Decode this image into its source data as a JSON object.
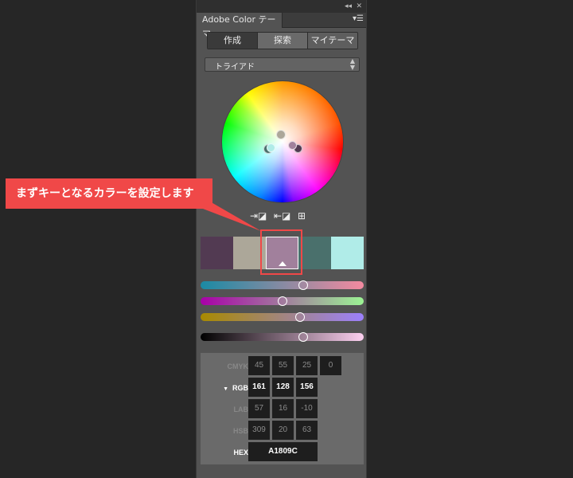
{
  "panel": {
    "title_tab": "Adobe Color テーマ",
    "titlebar_icons": [
      "collapse-icon",
      "close-icon"
    ],
    "menu_icon": "panel-menu-icon"
  },
  "modes": [
    {
      "label": "作成",
      "active": true
    },
    {
      "label": "探索",
      "active": false
    },
    {
      "label": "マイテーマ",
      "active": false
    }
  ],
  "harmony_rule": {
    "selected": "トライアド"
  },
  "actions": [
    {
      "name": "set-from-foreground-icon",
      "glyph": "⇥⧉"
    },
    {
      "name": "set-from-background-icon",
      "glyph": "⇤⧉"
    },
    {
      "name": "add-to-swatches-icon",
      "glyph": "▦"
    }
  ],
  "swatches": [
    {
      "color": "#523a52",
      "selected": false
    },
    {
      "color": "#aca799",
      "selected": false
    },
    {
      "color": "#a1809c",
      "selected": true
    },
    {
      "color": "#4a706c",
      "selected": false
    },
    {
      "color": "#b0ece8",
      "selected": false
    }
  ],
  "sliders": [
    {
      "name": "slider-1",
      "gradient": [
        "#1a8aa4",
        "#f48aa0"
      ],
      "value_pct": 63
    },
    {
      "name": "slider-2",
      "gradient": [
        "#a800a8",
        "#9cf494"
      ],
      "value_pct": 50
    },
    {
      "name": "slider-3",
      "gradient": [
        "#a88a00",
        "#9c80fc"
      ],
      "value_pct": 61
    },
    {
      "name": "brightness-slider",
      "gradient": [
        "#000000",
        "#fcd0f0"
      ],
      "value_pct": 63
    }
  ],
  "color_values": {
    "cmyk": {
      "label": "CMYK",
      "values": [
        "45",
        "55",
        "25",
        "0"
      ]
    },
    "rgb": {
      "label": "RGB",
      "values": [
        "161",
        "128",
        "156"
      ],
      "active": true
    },
    "lab": {
      "label": "LAB",
      "values": [
        "57",
        "16",
        "-10"
      ]
    },
    "hsb": {
      "label": "HSB",
      "values": [
        "309",
        "20",
        "63"
      ]
    },
    "hex": {
      "label": "HEX",
      "value": "A1809C"
    }
  },
  "annotation": {
    "text": "まずキーとなるカラーを設定します",
    "color": "#f04848"
  }
}
